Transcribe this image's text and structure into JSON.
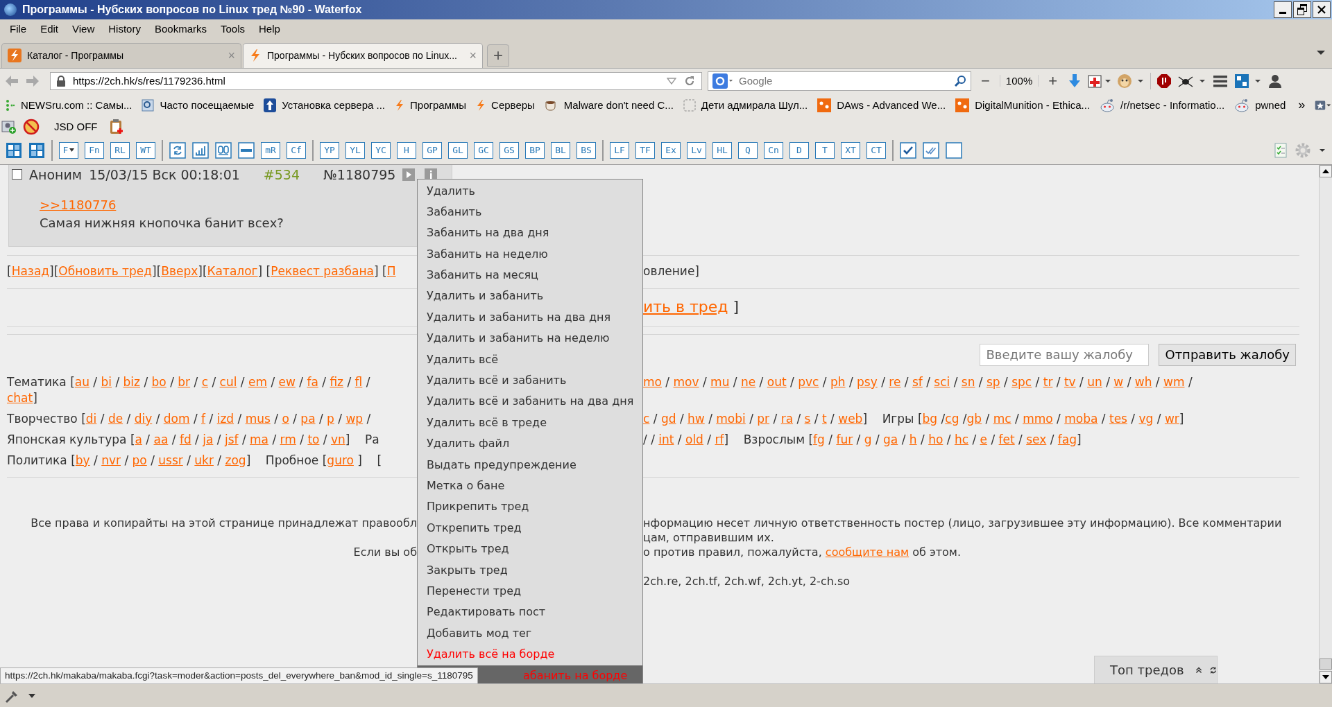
{
  "window": {
    "title": "Программы - Нубских вопросов по Linux тред №90 - Waterfox"
  },
  "menu_bar": [
    "File",
    "Edit",
    "View",
    "History",
    "Bookmarks",
    "Tools",
    "Help"
  ],
  "tabs": [
    {
      "label": "Каталог - Программы",
      "selected": false,
      "close": "×"
    },
    {
      "label": "Программы - Нубских вопросов по Linux...",
      "selected": true,
      "close": "×"
    }
  ],
  "new_tab": "+",
  "address_bar": {
    "url": "https://2ch.hk/s/res/1179236.html"
  },
  "search": {
    "placeholder": "Google"
  },
  "zoom": {
    "minus": "−",
    "level_text": "100%",
    "plus": "+"
  },
  "bookmarks": [
    {
      "label": "NEWSru.com :: Самы...",
      "kind": "dots"
    },
    {
      "label": "Часто посещаемые",
      "kind": "page"
    },
    {
      "label": "Установка сервера ...",
      "kind": "arrow"
    },
    {
      "label": "Программы",
      "kind": "bolt"
    },
    {
      "label": "Серверы",
      "kind": "bolt"
    },
    {
      "label": "Malware don't need C...",
      "kind": "cup"
    },
    {
      "label": "Дети адмирала Шул...",
      "kind": "dashed"
    },
    {
      "label": "DAws - Advanced We...",
      "kind": "orange"
    },
    {
      "label": "DigitalMunition - Ethica...",
      "kind": "orange"
    },
    {
      "label": "/r/netsec - Informatio...",
      "kind": "alien"
    },
    {
      "label": "pwned",
      "kind": "alien"
    }
  ],
  "bookmarks_more": "»",
  "addon_bar": {
    "label": "JSD OFF"
  },
  "toolbar": [
    [
      {
        "kind": "logo"
      },
      {
        "kind": "logo"
      }
    ],
    [
      {
        "kind": "text",
        "label": "F",
        "menu": true
      },
      {
        "kind": "text",
        "label": "Fn"
      },
      {
        "kind": "text",
        "label": "RL"
      },
      {
        "kind": "text",
        "label": "WT"
      }
    ],
    [
      {
        "kind": "refresh"
      },
      {
        "kind": "chart"
      },
      {
        "kind": "eyes"
      },
      {
        "kind": "bar"
      },
      {
        "kind": "text",
        "label": "mR"
      },
      {
        "kind": "text",
        "label": "Cf"
      }
    ],
    [
      {
        "kind": "text",
        "label": "YP"
      },
      {
        "kind": "text",
        "label": "YL"
      },
      {
        "kind": "text",
        "label": "YC"
      },
      {
        "kind": "text",
        "label": "H"
      },
      {
        "kind": "text",
        "label": "GP"
      },
      {
        "kind": "text",
        "label": "GL"
      },
      {
        "kind": "text",
        "label": "GC"
      },
      {
        "kind": "text",
        "label": "GS"
      },
      {
        "kind": "text",
        "label": "BP"
      },
      {
        "kind": "text",
        "label": "BL"
      },
      {
        "kind": "text",
        "label": "BS"
      }
    ],
    [
      {
        "kind": "text",
        "label": "LF"
      },
      {
        "kind": "text",
        "label": "TF"
      },
      {
        "kind": "text",
        "label": "Ex"
      },
      {
        "kind": "text",
        "label": "Lv"
      },
      {
        "kind": "text",
        "label": "HL"
      },
      {
        "kind": "text",
        "label": "Q"
      },
      {
        "kind": "text",
        "label": "Cn"
      },
      {
        "kind": "text",
        "label": "D"
      },
      {
        "kind": "text",
        "label": "T"
      },
      {
        "kind": "text",
        "label": "XT"
      },
      {
        "kind": "text",
        "label": "CT"
      }
    ],
    [
      {
        "kind": "check"
      },
      {
        "kind": "double-check"
      },
      {
        "kind": "empty"
      }
    ]
  ],
  "post": {
    "checked": false,
    "author": "Аноним",
    "date": "15/03/15 Вск 00:18:01",
    "number": "#534",
    "post_id": "№1180795",
    "reply_link": ">>1180776",
    "text": "Самая нижняя кнопочка банит всех?"
  },
  "thread_nav": {
    "left": [
      {
        "text": "["
      },
      {
        "link": "Назад"
      },
      {
        "text": "]["
      },
      {
        "link": "Обновить тред"
      },
      {
        "text": "]["
      },
      {
        "link": "Вверх"
      },
      {
        "text": "]["
      },
      {
        "link": "Каталог"
      },
      {
        "text": "] ["
      },
      {
        "link": "Реквест разбана"
      },
      {
        "text": "] ["
      },
      {
        "link": "П"
      }
    ],
    "right": [
      {
        "text": "овление]"
      }
    ]
  },
  "reply_to_thread": {
    "right": [
      {
        "link": "ить в тред"
      },
      {
        "text": " ]"
      }
    ]
  },
  "complaint": {
    "placeholder": "Введите вашу жалобу",
    "button": "Отправить жалобу"
  },
  "boards": [
    {
      "left": [
        {
          "text": "Тематика ["
        },
        {
          "link": "au"
        },
        {
          "text": " / "
        },
        {
          "link": "bi"
        },
        {
          "text": " / "
        },
        {
          "link": "biz"
        },
        {
          "text": " / "
        },
        {
          "link": "bo"
        },
        {
          "text": " / "
        },
        {
          "link": "br"
        },
        {
          "text": " / "
        },
        {
          "link": "c"
        },
        {
          "text": " / "
        },
        {
          "link": "cul"
        },
        {
          "text": " / "
        },
        {
          "link": "em"
        },
        {
          "text": " / "
        },
        {
          "link": "ew"
        },
        {
          "text": " / "
        },
        {
          "link": "fa"
        },
        {
          "text": " / "
        },
        {
          "link": "fiz"
        },
        {
          "text": " / "
        },
        {
          "link": "fl"
        },
        {
          "text": " /"
        }
      ],
      "right": [
        {
          "link": "mo"
        },
        {
          "text": " / "
        },
        {
          "link": "mov"
        },
        {
          "text": " / "
        },
        {
          "link": "mu"
        },
        {
          "text": " / "
        },
        {
          "link": "ne"
        },
        {
          "text": " / "
        },
        {
          "link": "out"
        },
        {
          "text": " / "
        },
        {
          "link": "pvc"
        },
        {
          "text": " / "
        },
        {
          "link": "ph"
        },
        {
          "text": " / "
        },
        {
          "link": "psy"
        },
        {
          "text": " / "
        },
        {
          "link": "re"
        },
        {
          "text": " / "
        },
        {
          "link": "sf"
        },
        {
          "text": " / "
        },
        {
          "link": "sci"
        },
        {
          "text": " / "
        },
        {
          "link": "sn"
        },
        {
          "text": " / "
        },
        {
          "link": "sp"
        },
        {
          "text": " / "
        },
        {
          "link": "spc"
        },
        {
          "text": " / "
        },
        {
          "link": "tr"
        },
        {
          "text": " / "
        },
        {
          "link": "tv"
        },
        {
          "text": " / "
        },
        {
          "link": "un"
        },
        {
          "text": " / "
        },
        {
          "link": "w"
        },
        {
          "text": " / "
        },
        {
          "link": "wh"
        },
        {
          "text": " / "
        },
        {
          "link": "wm"
        },
        {
          "text": " /"
        }
      ]
    },
    {
      "left": [
        {
          "link": "chat"
        },
        {
          "text": "]"
        }
      ]
    },
    {
      "left": [
        {
          "text": "Творчество ["
        },
        {
          "link": "di"
        },
        {
          "text": " / "
        },
        {
          "link": "de"
        },
        {
          "text": " / "
        },
        {
          "link": "diy"
        },
        {
          "text": " / "
        },
        {
          "link": "dom"
        },
        {
          "text": " / "
        },
        {
          "link": "f"
        },
        {
          "text": " / "
        },
        {
          "link": "izd"
        },
        {
          "text": " / "
        },
        {
          "link": "mus"
        },
        {
          "text": " / "
        },
        {
          "link": "o"
        },
        {
          "text": " / "
        },
        {
          "link": "pa"
        },
        {
          "text": " / "
        },
        {
          "link": "p"
        },
        {
          "text": " / "
        },
        {
          "link": "wp"
        },
        {
          "text": " /"
        }
      ],
      "right": [
        {
          "link": "c"
        },
        {
          "text": " / "
        },
        {
          "link": "gd"
        },
        {
          "text": " / "
        },
        {
          "link": "hw"
        },
        {
          "text": " / "
        },
        {
          "link": "mobi"
        },
        {
          "text": " / "
        },
        {
          "link": "pr"
        },
        {
          "text": " / "
        },
        {
          "link": "ra"
        },
        {
          "text": " / "
        },
        {
          "link": "s"
        },
        {
          "text": " / "
        },
        {
          "link": "t"
        },
        {
          "text": " / "
        },
        {
          "link": "web"
        },
        {
          "text": "]    Игры ["
        },
        {
          "link": "bg"
        },
        {
          "text": " /"
        },
        {
          "link": "cg"
        },
        {
          "text": " /"
        },
        {
          "link": "gb"
        },
        {
          "text": " / "
        },
        {
          "link": "mc"
        },
        {
          "text": " / "
        },
        {
          "link": "mmo"
        },
        {
          "text": " / "
        },
        {
          "link": "moba"
        },
        {
          "text": " / "
        },
        {
          "link": "tes"
        },
        {
          "text": " / "
        },
        {
          "link": "vg"
        },
        {
          "text": " / "
        },
        {
          "link": "wr"
        },
        {
          "text": "]"
        }
      ]
    },
    {
      "left": [
        {
          "text": "Японская культура ["
        },
        {
          "link": "a"
        },
        {
          "text": " / "
        },
        {
          "link": "aa"
        },
        {
          "text": " / "
        },
        {
          "link": "fd"
        },
        {
          "text": " / "
        },
        {
          "link": "ja"
        },
        {
          "text": " / "
        },
        {
          "link": "jsf"
        },
        {
          "text": " / "
        },
        {
          "link": "ma"
        },
        {
          "text": " / "
        },
        {
          "link": "rm"
        },
        {
          "text": " / "
        },
        {
          "link": "to"
        },
        {
          "text": " / "
        },
        {
          "link": "vn"
        },
        {
          "text": "]    Ра"
        }
      ],
      "right": [
        {
          "text": "/ / "
        },
        {
          "link": "int"
        },
        {
          "text": " / "
        },
        {
          "link": "old"
        },
        {
          "text": " / "
        },
        {
          "link": "rf"
        },
        {
          "text": "]    Взрослым ["
        },
        {
          "link": "fg"
        },
        {
          "text": " / "
        },
        {
          "link": "fur"
        },
        {
          "text": " / "
        },
        {
          "link": "g"
        },
        {
          "text": " / "
        },
        {
          "link": "ga"
        },
        {
          "text": " / "
        },
        {
          "link": "h"
        },
        {
          "text": " / "
        },
        {
          "link": "ho"
        },
        {
          "text": " / "
        },
        {
          "link": "hc"
        },
        {
          "text": " / "
        },
        {
          "link": "e"
        },
        {
          "text": " / "
        },
        {
          "link": "fet"
        },
        {
          "text": " / "
        },
        {
          "link": "sex"
        },
        {
          "text": " / "
        },
        {
          "link": "fag"
        },
        {
          "text": "]"
        }
      ]
    },
    {
      "left": [
        {
          "text": "Политика ["
        },
        {
          "link": "by"
        },
        {
          "text": " / "
        },
        {
          "link": "nvr"
        },
        {
          "text": " / "
        },
        {
          "link": "po"
        },
        {
          "text": " / "
        },
        {
          "link": "ussr"
        },
        {
          "text": " / "
        },
        {
          "link": "ukr"
        },
        {
          "text": " / "
        },
        {
          "link": "zog"
        },
        {
          "text": "]    Пробное ["
        },
        {
          "link": "guro"
        },
        {
          "text": " ]    ["
        }
      ]
    }
  ],
  "footer": [
    {
      "left": [
        {
          "text": "Все права и копирайты на этой странице принадлежат правообл"
        }
      ],
      "right": [
        {
          "text": "нформацию несет личную ответственность постер (лицо, загрузившее эту информацию). Все комментарии"
        }
      ]
    },
    {
      "right": [
        {
          "text": "цам, отправившим их."
        }
      ]
    },
    {
      "left": [
        {
          "text": "Если вы об"
        }
      ],
      "right": [
        {
          "text": "о против правил, пожалуйста, "
        },
        {
          "link": "сообщите нам"
        },
        {
          "text": " об этом."
        }
      ]
    },
    {
      "right": [
        {
          "text": "2ch.re, 2ch.tf, 2ch.wf, 2ch.yt, 2-ch.so"
        }
      ]
    }
  ],
  "context_menu": [
    {
      "label": "Удалить",
      "kind": "normal",
      "selected": false
    },
    {
      "label": "Забанить",
      "kind": "normal",
      "selected": false
    },
    {
      "label": "Забанить на два дня",
      "kind": "normal",
      "selected": false
    },
    {
      "label": "Забанить на неделю",
      "kind": "normal",
      "selected": false
    },
    {
      "label": "Забанить на месяц",
      "kind": "normal",
      "selected": false
    },
    {
      "label": "Удалить и забанить",
      "kind": "normal",
      "selected": false
    },
    {
      "label": "Удалить и забанить на два дня",
      "kind": "normal",
      "selected": false
    },
    {
      "label": "Удалить и забанить на неделю",
      "kind": "normal",
      "selected": false
    },
    {
      "label": "Удалить всё",
      "kind": "normal",
      "selected": false
    },
    {
      "label": "Удалить всё и забанить",
      "kind": "normal",
      "selected": false
    },
    {
      "label": "Удалить всё и забанить на два дня",
      "kind": "normal",
      "selected": false
    },
    {
      "label": "Удалить всё в треде",
      "kind": "normal",
      "selected": false
    },
    {
      "label": "Удалить файл",
      "kind": "normal",
      "selected": false
    },
    {
      "label": "Выдать предупреждение",
      "kind": "normal",
      "selected": false
    },
    {
      "label": "Метка о бане",
      "kind": "normal",
      "selected": false
    },
    {
      "label": "Прикрепить тред",
      "kind": "normal",
      "selected": false
    },
    {
      "label": "Открепить тред",
      "kind": "normal",
      "selected": false
    },
    {
      "label": "Открыть тред",
      "kind": "normal",
      "selected": false
    },
    {
      "label": "Закрыть тред",
      "kind": "normal",
      "selected": false
    },
    {
      "label": "Перенести тред",
      "kind": "normal",
      "selected": false
    },
    {
      "label": "Редактировать пост",
      "kind": "normal",
      "selected": false
    },
    {
      "label": "Добавить мод тег",
      "kind": "normal",
      "selected": false
    },
    {
      "label": "Удалить всё на борде",
      "kind": "danger",
      "selected": false
    },
    {
      "label": "абанить на борде",
      "kind": "danger",
      "selected": true
    }
  ],
  "status_url": "https://2ch.hk/makaba/makaba.fcgi?task=moder&action=posts_del_everywhere_ban&mod_id_single=s_1180795",
  "top_threads": {
    "label": "Топ тредов"
  }
}
